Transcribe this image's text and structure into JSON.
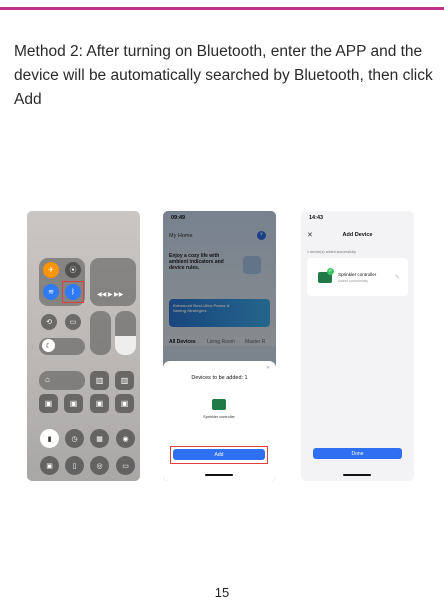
{
  "instruction": "Method 2: After turning on Bluetooth, enter the APP and the device will be automatically searched by Bluetooth, then click Add",
  "page_number": "15",
  "colors": {
    "accent_line": "#c2308e",
    "primary_button": "#2f6ff2",
    "highlight": "#e0403b"
  },
  "screenshot1": {
    "cc_icons": [
      "airplane-icon",
      "cellular-icon",
      "wifi-icon",
      "bluetooth-icon",
      "orientation-lock-icon",
      "mirror-icon",
      "moon-icon",
      "home-icon",
      "flashlight-icon",
      "timer-icon",
      "calculator-icon",
      "camera-icon",
      "qr-icon",
      "remote-icon",
      "record-icon",
      "battery-icon"
    ]
  },
  "screenshot2": {
    "time": "09:49",
    "home_name": "My Home",
    "banner_title": "Enjoy a cozy life with ambient indicators and device rules.",
    "promo_title": "Enhanced Best-Ultra Power & Saving Strategies",
    "tabs": [
      "All Devices",
      "Living Room",
      "Master R"
    ],
    "sheet_title": "Devices to be added: 1",
    "device_label": "Sprinkler controller",
    "add_button": "Add"
  },
  "screenshot3": {
    "time": "14:43",
    "title": "Add Device",
    "added_count": "1 device(s) added successfully",
    "device_name": "Sprinkler controller",
    "device_status": "Added successfully",
    "done_button": "Done"
  }
}
